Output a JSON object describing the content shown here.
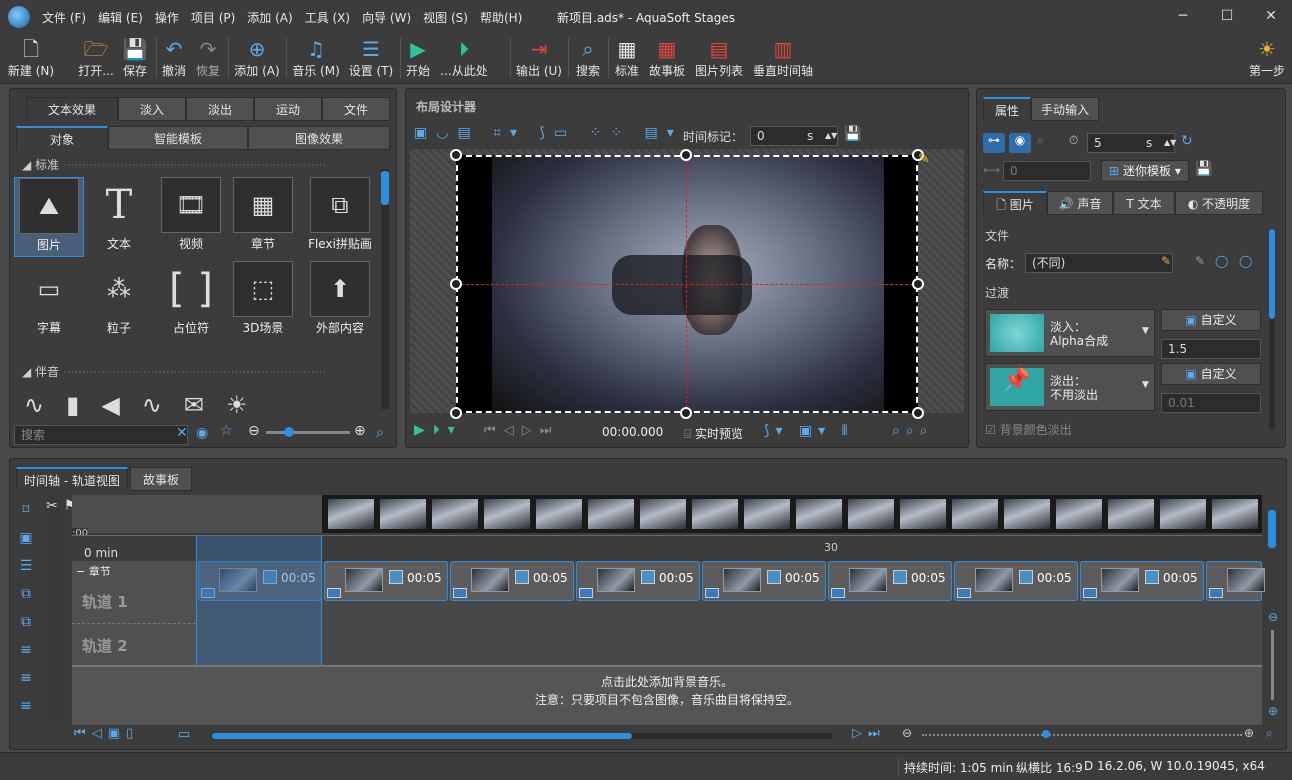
{
  "app": {
    "title": "新项目.ads* - AquaSoft Stages"
  },
  "menu": [
    "文件 (F)",
    "编辑 (E)",
    "操作",
    "项目 (P)",
    "添加 (A)",
    "工具 (X)",
    "向导 (W)",
    "视图 (S)",
    "帮助(H)"
  ],
  "toolbar": {
    "new": "新建 (N)",
    "open": "打开...",
    "save": "保存",
    "undo": "撤消",
    "redo": "恢复",
    "add": "添加 (A)",
    "music": "音乐 (M)",
    "settings": "设置 (T)",
    "start": "开始",
    "from_here": "...从此处",
    "output": "输出 (U)",
    "search": "搜索",
    "standard": "标准",
    "storyboard": "故事板",
    "image_list": "图片列表",
    "vertical_timeline": "垂直时间轴",
    "first_step": "第一步"
  },
  "left_panel": {
    "tabs_row1": [
      "文本效果",
      "淡入",
      "淡出",
      "运动",
      "文件"
    ],
    "tabs_row2": [
      "对象",
      "智能模板",
      "图像效果"
    ],
    "section_standard": "标准",
    "section_audio": "伴音",
    "objects": [
      "图片",
      "文本",
      "视频",
      "章节",
      "Flexi拼贴画",
      "字幕",
      "粒子",
      "占位符",
      "3D场景",
      "外部内容"
    ],
    "search_placeholder": "搜索"
  },
  "designer": {
    "title": "布局设计器",
    "time_marker_label": "时间标记：",
    "time_marker_value": "0",
    "time_unit": "s",
    "playback_time": "00:00.000",
    "live_preview": "实时预览"
  },
  "props": {
    "tabs": [
      "属性",
      "手动输入"
    ],
    "duration_value": "5",
    "duration_unit": "s",
    "offset_value": "0",
    "mini_template": "迷你模板",
    "subtabs": [
      "图片",
      "声音",
      "文本",
      "不透明度"
    ],
    "file_section": "文件",
    "name_label": "名称：",
    "name_value": "(不同)",
    "transition_section": "过渡",
    "fade_in_label": "淡入：",
    "fade_in_value": "Alpha合成",
    "fade_in_custom": "自定义",
    "fade_in_duration": "1.5",
    "fade_out_label": "淡出：",
    "fade_out_value": "不用淡出",
    "fade_out_custom": "自定义",
    "fade_out_duration": "0.01",
    "bg_fade": "背景颜色淡出"
  },
  "timeline": {
    "tabs": [
      "时间轴 - 轨道视图",
      "故事板"
    ],
    "ruler_start": "0 min",
    "ruler_mid": "30",
    "chapter": "章节",
    "track1": "轨道 1",
    "track2": "轨道 2",
    "clip_duration": "00:05",
    "music_hint1": "点击此处添加背景音乐。",
    "music_hint2": "注意：只要项目不包含图像，音乐曲目将保持空。",
    "marker": ":00"
  },
  "status": {
    "duration": "持续时间: 1:05 min",
    "aspect": "纵横比 16:9",
    "version": "D 16.2.06, W 10.0.19045, x64"
  },
  "colors": {
    "accent": "#2d8fe0",
    "bg": "#4a4a4a",
    "panel": "#3c3c3c"
  }
}
